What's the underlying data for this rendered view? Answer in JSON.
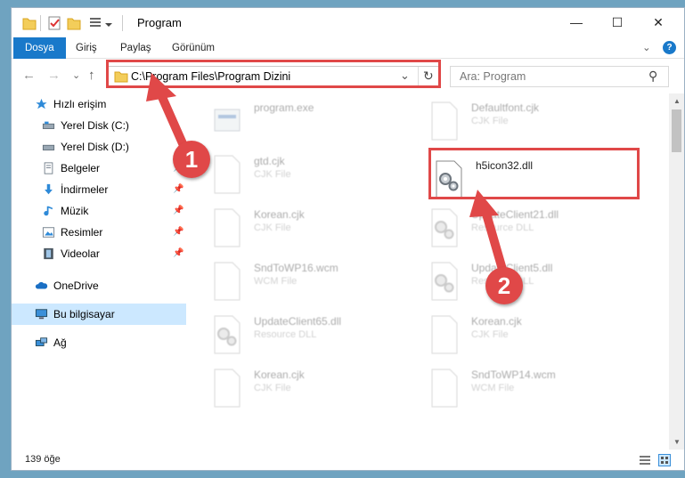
{
  "window": {
    "title": "Program",
    "minimize_glyph": "—",
    "maximize_glyph": "☐",
    "close_glyph": "✕"
  },
  "ribbon": {
    "tabs": [
      "Dosya",
      "Giriş",
      "Paylaş",
      "Görünüm"
    ],
    "expand_glyph": "⌄",
    "help_glyph": "?"
  },
  "navigation": {
    "back_glyph": "←",
    "forward_glyph": "→",
    "recent_glyph": "⌄",
    "up_glyph": "↑",
    "address": "C:\\Program Files\\Program Dizini",
    "address_dropdown_glyph": "⌄",
    "refresh_glyph": "↻",
    "search_placeholder": "Ara: Program",
    "search_glyph": "⚲"
  },
  "sidebar": {
    "items": [
      {
        "label": "Hızlı erişim",
        "icon": "star-icon",
        "pinned": false
      },
      {
        "label": "Yerel Disk (C:)",
        "icon": "drive-icon",
        "pinned": false
      },
      {
        "label": "Yerel Disk (D:)",
        "icon": "drive-icon",
        "pinned": false
      },
      {
        "label": "Belgeler",
        "icon": "documents-icon",
        "pinned": true
      },
      {
        "label": "İndirmeler",
        "icon": "downloads-icon",
        "pinned": true
      },
      {
        "label": "Müzik",
        "icon": "music-icon",
        "pinned": true
      },
      {
        "label": "Resimler",
        "icon": "pictures-icon",
        "pinned": true
      },
      {
        "label": "Videolar",
        "icon": "videos-icon",
        "pinned": true
      },
      {
        "label": "OneDrive",
        "icon": "cloud-icon",
        "pinned": false
      },
      {
        "label": "Bu bilgisayar",
        "icon": "computer-icon",
        "pinned": false
      },
      {
        "label": "Ağ",
        "icon": "network-icon",
        "pinned": false
      }
    ],
    "pin_glyph": "📌"
  },
  "files": [
    {
      "name": "program.exe",
      "type": "",
      "icon": "exe-icon",
      "highlighted": false
    },
    {
      "name": "Defaultfont.cjk",
      "type": "CJK File",
      "icon": "generic-file-icon",
      "highlighted": false
    },
    {
      "name": "gtd.cjk",
      "type": "CJK File",
      "icon": "generic-file-icon",
      "highlighted": false
    },
    {
      "name": "h5icon32.dll",
      "type": "",
      "icon": "dll-gear-icon",
      "highlighted": true
    },
    {
      "name": "Korean.cjk",
      "type": "CJK File",
      "icon": "generic-file-icon",
      "highlighted": false
    },
    {
      "name": "UpdateClient21.dll",
      "type": "Resource DLL",
      "icon": "dll-gear-icon",
      "highlighted": false
    },
    {
      "name": "SndToWP16.wcm",
      "type": "WCM File",
      "icon": "generic-file-icon",
      "highlighted": false
    },
    {
      "name": "UpdateClient5.dll",
      "type": "Resource DLL",
      "icon": "dll-gear-icon",
      "highlighted": false
    },
    {
      "name": "UpdateClient65.dll",
      "type": "Resource DLL",
      "icon": "dll-gear-icon",
      "highlighted": false
    },
    {
      "name": "Korean.cjk",
      "type": "CJK File",
      "icon": "generic-file-icon",
      "highlighted": false
    },
    {
      "name": "Korean.cjk",
      "type": "CJK File",
      "icon": "generic-file-icon",
      "highlighted": false
    },
    {
      "name": "SndToWP14.wcm",
      "type": "WCM File",
      "icon": "generic-file-icon",
      "highlighted": false
    }
  ],
  "status": {
    "item_count": "139 öğe"
  },
  "annotations": {
    "step1": "1",
    "step2": "2",
    "color": "#e04848"
  },
  "colors": {
    "accent": "#1979ca",
    "selected_bg": "#cce8ff",
    "desktop": "#6fa3c0"
  }
}
